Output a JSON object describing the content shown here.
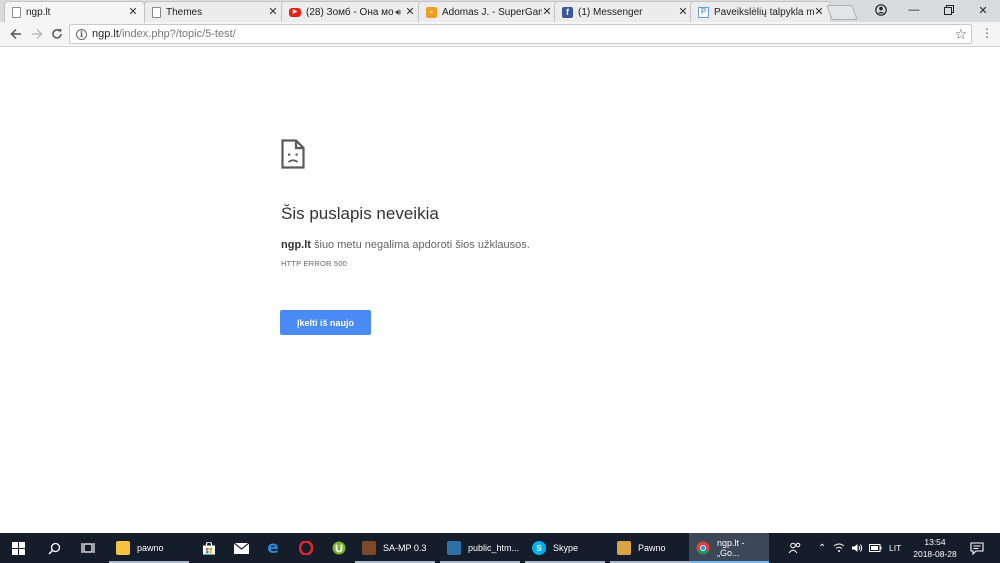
{
  "tabs": [
    {
      "title": "ngp.lt",
      "icon": "page-icon",
      "active": true
    },
    {
      "title": "Themes",
      "icon": "page-icon"
    },
    {
      "title": "(28) Зомб - Она мо",
      "icon": "youtube-icon",
      "audio": true
    },
    {
      "title": "Adomas J. - SuperGame",
      "icon": "supergame-icon"
    },
    {
      "title": "(1) Messenger",
      "icon": "facebook-icon"
    },
    {
      "title": "Paveikslėlių talpykla mo",
      "icon": "upload-icon"
    }
  ],
  "toolbar": {
    "url_host": "ngp.lt",
    "url_path": "/index.php?/topic/5-test/"
  },
  "error_page": {
    "heading": "Šis puslapis neveikia",
    "host": "ngp.lt",
    "description": " šiuo metu negalima apdoroti šios užklausos.",
    "error_code": "HTTP ERROR 500",
    "reload_label": "Įkelti iš naujo",
    "button_color": "#4a8af4"
  },
  "taskbar": {
    "apps": [
      {
        "label": "pawno",
        "icon": "folder-icon"
      },
      {
        "label": "SA-MP 0.3",
        "icon": "samp-icon"
      },
      {
        "label": "public_htm...",
        "icon": "ftp-icon"
      },
      {
        "label": "Skype",
        "icon": "skype-icon"
      },
      {
        "label": "Pawno",
        "icon": "pawno-icon"
      },
      {
        "label": "ngp.lt - „Go...",
        "icon": "chrome-icon"
      }
    ],
    "language": "LIT",
    "time": "13:54",
    "date": "2018-08-28"
  }
}
